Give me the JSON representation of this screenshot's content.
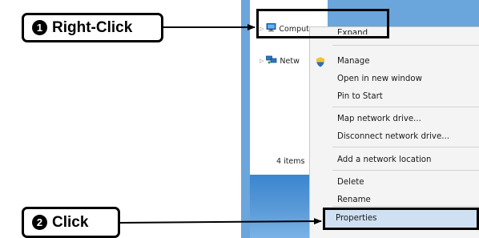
{
  "callouts": {
    "step1": {
      "number": "1",
      "label": "Right-Click"
    },
    "step2": {
      "number": "2",
      "label": "Click"
    }
  },
  "explorer": {
    "nav": {
      "computer_label": "Computer",
      "network_label": "Netw"
    },
    "status_count": "4 items"
  },
  "context_menu": {
    "items": [
      {
        "label": "Expand",
        "group": 0
      },
      {
        "label": "Manage",
        "group": 1,
        "icon": "uac-shield-icon"
      },
      {
        "label": "Open in new window",
        "group": 1
      },
      {
        "label": "Pin to Start",
        "group": 1
      },
      {
        "label": "Map network drive...",
        "group": 2
      },
      {
        "label": "Disconnect network drive...",
        "group": 2
      },
      {
        "label": "Add a network location",
        "group": 3
      },
      {
        "label": "Delete",
        "group": 4
      },
      {
        "label": "Rename",
        "group": 4
      },
      {
        "label": "Properties",
        "group": 5,
        "highlighted": true
      }
    ]
  },
  "colors": {
    "window_blue": "#6aa5dc",
    "menu_background": "#f4f4f4",
    "highlight": "#cfe0f2",
    "callout_border": "#000000"
  }
}
